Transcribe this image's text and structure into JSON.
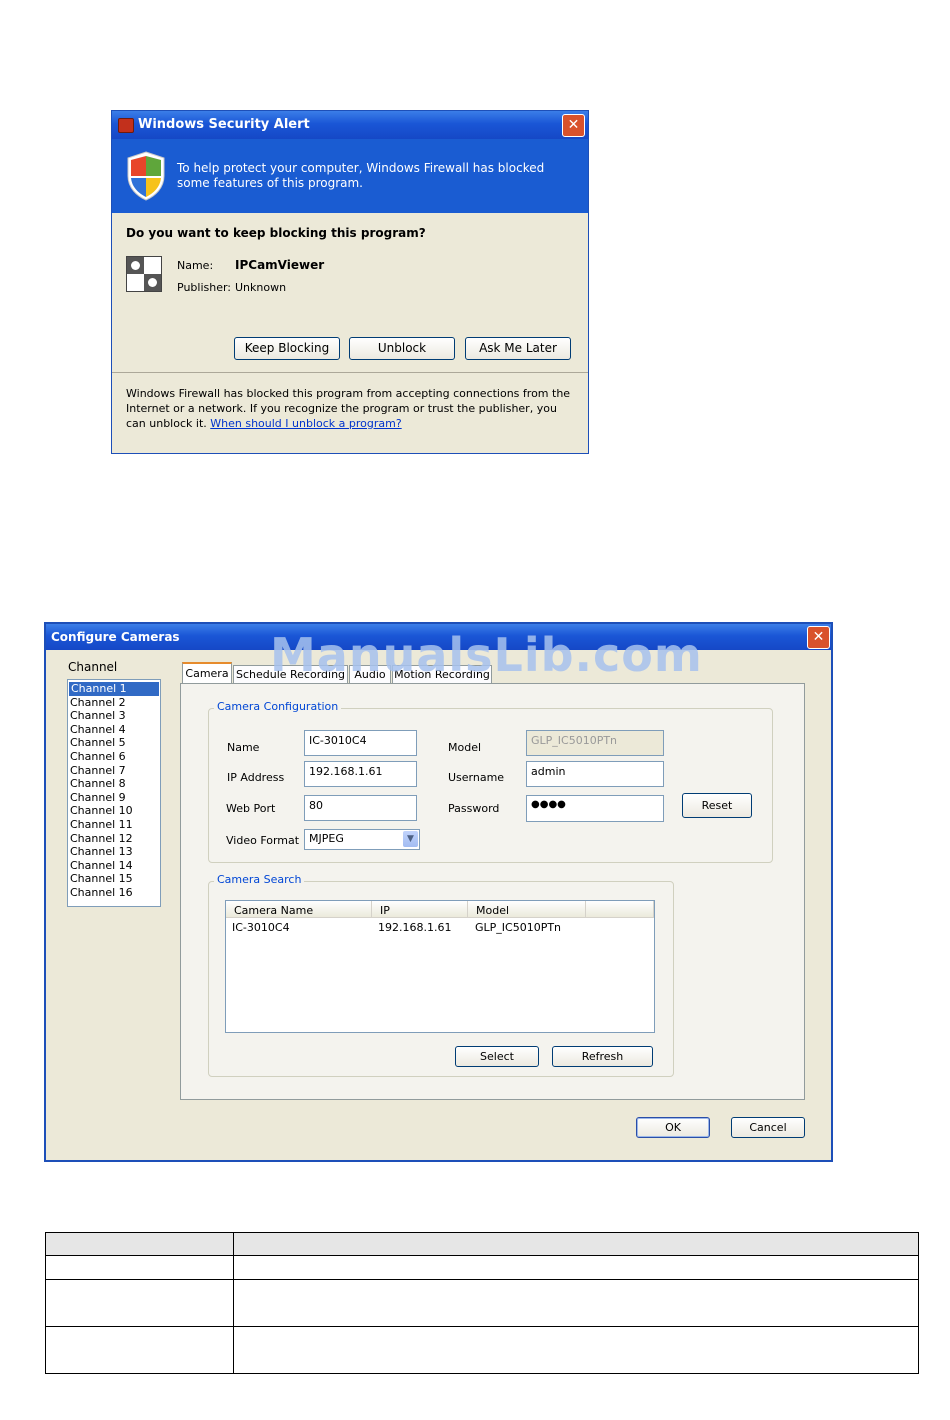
{
  "security_alert": {
    "title": "Windows Security Alert",
    "banner_text": "To help protect your computer,  Windows Firewall has blocked some features of this program.",
    "question": "Do you want to keep blocking this program?",
    "name_label": "Name:",
    "name_value": "IPCamViewer",
    "publisher_label": "Publisher:",
    "publisher_value": "Unknown",
    "buttons": {
      "keep_blocking": "Keep Blocking",
      "unblock": "Unblock",
      "ask_me_later": "Ask Me Later"
    },
    "footer_text": "Windows Firewall has blocked this program from accepting connections from the Internet or a network. If you recognize the program or trust the publisher, you can unblock it.",
    "footer_link": "When should I unblock a program?"
  },
  "configure_cameras": {
    "title": "Configure Cameras",
    "watermark": "ManualsLib.com",
    "channel_label": "Channel",
    "channels": [
      "Channel 1",
      "Channel 2",
      "Channel 3",
      "Channel 4",
      "Channel 5",
      "Channel 6",
      "Channel 7",
      "Channel 8",
      "Channel 9",
      "Channel 10",
      "Channel 11",
      "Channel 12",
      "Channel 13",
      "Channel 14",
      "Channel 15",
      "Channel 16"
    ],
    "tabs": [
      "Camera",
      "Schedule Recording",
      "Audio",
      "Motion Recording"
    ],
    "camera_configuration": {
      "title": "Camera Configuration",
      "name_label": "Name",
      "name_value": "IC-3010C4",
      "ip_label": "IP Address",
      "ip_value": "192.168.1.61",
      "port_label": "Web Port",
      "port_value": "80",
      "format_label": "Video Format",
      "format_value": "MJPEG",
      "model_label": "Model",
      "model_value": "GLP_IC5010PTn",
      "username_label": "Username",
      "username_value": "admin",
      "password_label": "Password",
      "password_value": "●●●●",
      "reset_label": "Reset"
    },
    "camera_search": {
      "title": "Camera Search",
      "columns": [
        "Camera Name",
        "IP",
        "Model"
      ],
      "rows": [
        {
          "name": "IC-3010C4",
          "ip": "192.168.1.61",
          "model": "GLP_IC5010PTn"
        }
      ],
      "select_label": "Select",
      "refresh_label": "Refresh"
    },
    "ok_label": "OK",
    "cancel_label": "Cancel"
  }
}
